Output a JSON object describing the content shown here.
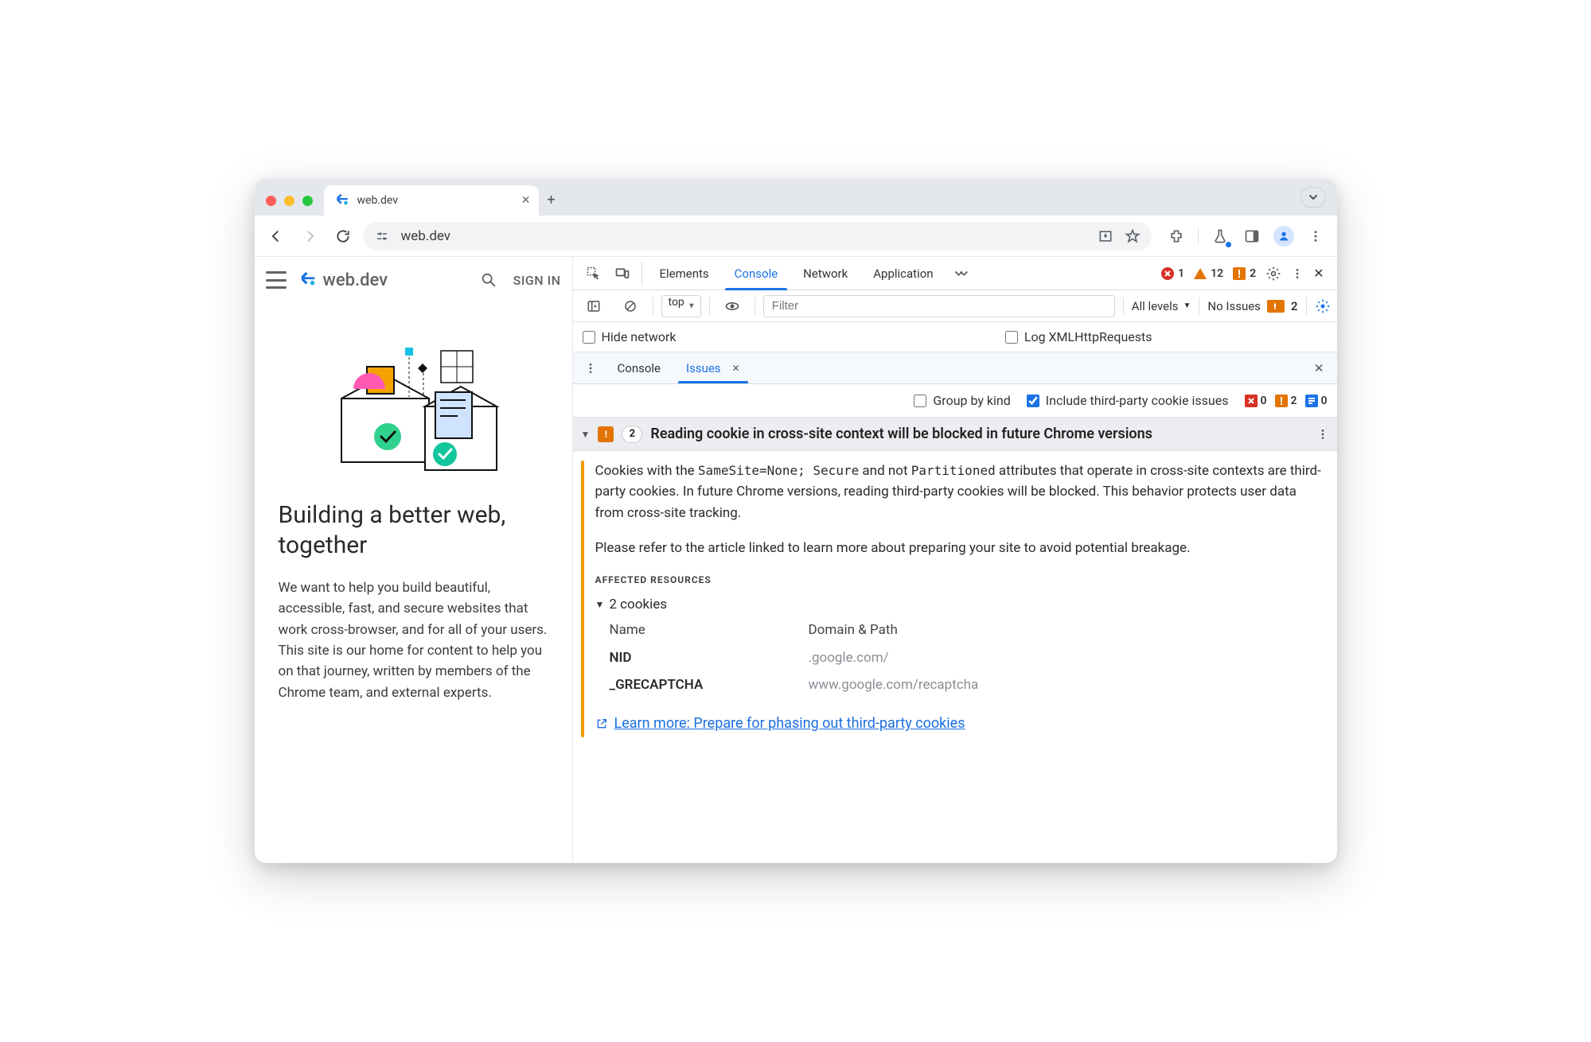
{
  "browser": {
    "tab_title": "web.dev",
    "url": "web.dev",
    "new_tab_tooltip": "+"
  },
  "page": {
    "brand": "web.dev",
    "sign_in": "SIGN IN",
    "heading": "Building a better web, together",
    "paragraph": "We want to help you build beautiful, accessible, fast, and secure websites that work cross-browser, and for all of your users. This site is our home for content to help you on that journey, written by members of the Chrome team, and external experts."
  },
  "devtools": {
    "tabs": [
      "Elements",
      "Console",
      "Network",
      "Application"
    ],
    "active_tab": "Console",
    "counts": {
      "errors": 1,
      "warnings": 12,
      "open_issues": 2
    },
    "console_toolbar": {
      "context": "top",
      "filter_placeholder": "Filter",
      "levels": "All levels",
      "no_issues_label": "No Issues",
      "no_issues_count": 2
    },
    "checkboxes": {
      "hide_network": "Hide network",
      "log_xhr": "Log XMLHttpRequests"
    },
    "drawer": {
      "tabs": [
        "Console",
        "Issues"
      ],
      "active": "Issues"
    },
    "issues_filters": {
      "group_by_kind": "Group by kind",
      "include_3p": "Include third-party cookie issues",
      "counts": {
        "page_errors": 0,
        "breaking": 2,
        "improvements": 0
      }
    },
    "issue": {
      "count": 2,
      "title": "Reading cookie in cross-site context will be blocked in future Chrome versions",
      "body_parts": {
        "p1a": "Cookies with the ",
        "code1": "SameSite=None; Secure",
        "p1b": " and not ",
        "code2": "Partitioned",
        "p1c": " attributes that operate in cross-site contexts are third-party cookies. In future Chrome versions, reading third-party cookies will be blocked. This behavior protects user data from cross-site tracking.",
        "p2": "Please refer to the article linked to learn more about preparing your site to avoid potential breakage."
      },
      "affected_label": "AFFECTED RESOURCES",
      "cookies_disclosure": "2 cookies",
      "table": {
        "col1": "Name",
        "col2": "Domain & Path",
        "rows": [
          {
            "name": "NID",
            "domain": ".google.com/"
          },
          {
            "name": "_GRECAPTCHA",
            "domain": "www.google.com/recaptcha"
          }
        ]
      },
      "learn_more": "Learn more: Prepare for phasing out third-party cookies"
    }
  }
}
